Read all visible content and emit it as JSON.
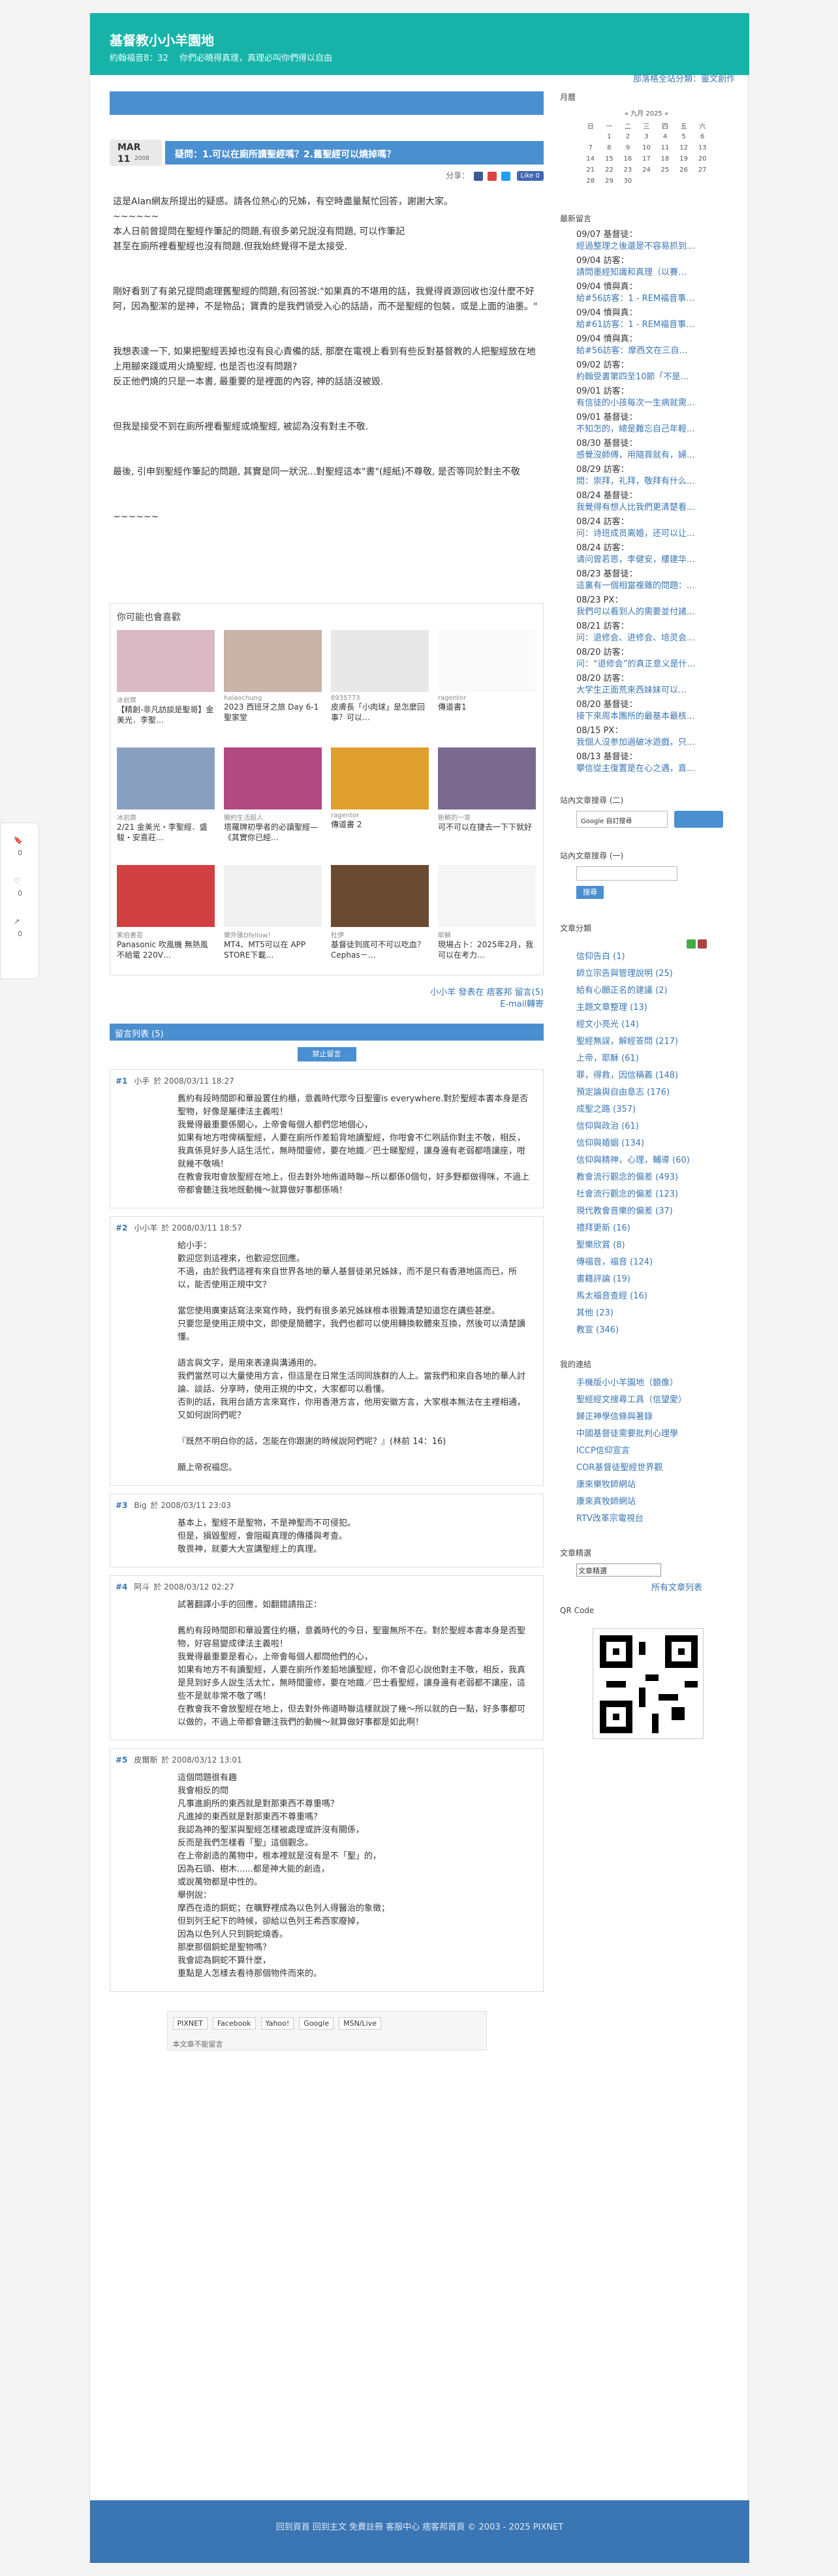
{
  "blog": {
    "title": "基督教小小羊園地",
    "desc": "約翰福音8：32 　你們必曉得真理，真理必叫你們得以自由",
    "toplink": "部落格全站分類：靈文創作"
  },
  "post": {
    "month": "MAR",
    "day": "11",
    "year": "2008",
    "title": "疑問：1.可以在廁所讀聖經嗎？2.舊聖經可以燒掉嗎？",
    "share_label": "分享：",
    "fb_like": "Like 0",
    "paragraphs": [
      "這是Alan網友所提出的疑惑。請各位熱心的兄姊，有空時盡量幫忙回答，謝謝大家。\n~~~~~~\n本人日前曾提問在聖經作筆記的問題,有很多弟兄說沒有問題, 可以作筆記\n甚至在廁所裡看聖經也沒有問題.但我始終覺得不是太接受.",
      "剛好看到了有弟兄提問處理舊聖經的問題,有回答說:\"如果真的不堪用的話，我覺得資源回收也沒什麼不好阿，因為聖潔的是神，不是物品；寶貴的是我們領受入心的話語，而不是聖經的包裝，或是上面的油墨。\"",
      "我想表達一下, 如果把聖經丟掉也沒有良心責備的話, 那麼在電視上看到有些反對基督教的人把聖經放在地上用腳來踐或用火燒聖經, 也是否也沒有問題?\n反正他們燒的只是一本書, 最重要的是裡面的內容, 神的話語沒被毀.",
      "但我是接受不到在廁所裡看聖經或燒聖經, 被認為沒有對主不敬.",
      "最後, 引申到聖經作筆記的問題, 其實是同一狀況...對聖經這本\"書\"(經紙)不尊敬, 是否等同於對主不敬",
      "~~~~~~"
    ],
    "related_title": "你可能也會喜歡",
    "related": [
      {
        "author": "冰岩齊",
        "title": "【精創-非凡訪談是聖哥】金美光．李聖…"
      },
      {
        "author": "haiaochung",
        "title": "2023 西班牙之旅 Day 6-1 聖家堂"
      },
      {
        "author": "8935773",
        "title": "皮膚長「小肉球」是怎麼回事？可以…"
      },
      {
        "author": "ragentor",
        "title": "傳道書1"
      },
      {
        "author": "冰岩齊",
        "title": "2/21 金美光・李聖經．盛駿・安喜莊…"
      },
      {
        "author": "簡約生活超人",
        "title": "塔羅牌初學者的必讀聖經—《其實你已經…"
      },
      {
        "author": "ragentor",
        "title": "傳道書 2"
      },
      {
        "author": "新鮮的一哥",
        "title": "可不可以在捷去一下下就好"
      },
      {
        "author": "紫伯書芸",
        "title": "Panasonic 吹風機 無熱風 不給電 220V…"
      },
      {
        "author": "樂外匯Dfellow！",
        "title": "MT4、MT5可以在 APP STORE下載…"
      },
      {
        "author": "杜伊",
        "title": "基督徒到底可不可以吃血？ Cephas－…"
      },
      {
        "author": "耶穌",
        "title": "現場占卜：2025年2月，我可以在考力…"
      }
    ],
    "footer_line1": "小小羊 發表在 痞客邦 留言(5)",
    "footer_line2": "E-mail轉寄"
  },
  "comments": {
    "header": "留言列表 (5)",
    "button": "禁止留言",
    "items": [
      {
        "num": "#1",
        "author": "小手",
        "date": "於 2008/03/11 18:27",
        "body": "舊約有段時間即和華設置住約櫃，意義時代眾今日聖靈is everywhere.對於聖經本書本身是否聖物，好像是屬律法主義啦！\n我覺得最重要係關心，上帝會每個人都們您地個心，\n如果有地方咁俾稱聖經，人要在廁所作差鉛背地讀聖經，你咁會不仁咧話你對主不敬，相反，我真係見好多人話生活忙，無時間靈修，要在地鐵／巴士睇聖經，讓身邊有老弱都唔讓座，咁就幾不敬喎！\n在教會我咁會放聖經在地上，但去對外地佈道時聯~所以都係0個句，好多野都做得咪，不過上帝都會聽注我地既動機～就算做好事都係喎！"
      },
      {
        "num": "#2",
        "author": "小小羊",
        "date": "於 2008/03/11 18:57",
        "body": "給小手：\n歡迎您到這裡來，也歡迎您回應。\n不過，由於我們這裡有來自世界各地的華人基督徒弟兄姊妹，而不是只有香港地區而已，所以，能否使用正規中文？\n\n當您使用廣東話寫法來寫作時，我們有很多弟兄姊妹根本很難清楚知道您在講些甚麼。\n只要您是使用正規中文，即使是簡體字，我們也都可以使用轉換軟體來互換，然後可以清楚讀懂。\n\n語言與文字，是用來表達與溝通用的。\n我們當然可以大量使用方言，但這是在日常生活同同族群的人上。當我們和來自各地的華人討論、談話、分享時，使用正規的中文，大家都可以看懂。\n否則的話，我用台語方言來寫作，你用香港方言，他用安徽方言，大家根本無法在主裡相通，又如何說同們呢？\n\n『既然不明白你的話，怎能在你跟謝的時候說阿們呢？』(林前 14：16)\n\n願上帝祝福您。"
      },
      {
        "num": "#3",
        "author": "Big",
        "date": "於 2008/03/11 23:03",
        "body": "基本上，聖經不是聖物，不是神聖而不可侵犯。\n但是，損毀聖經，會阻礙真理的傳播與考查。\n敬畏神，就要大大宣講聖經上的真理。"
      },
      {
        "num": "#4",
        "author": "阿斗",
        "date": "於 2008/03/12 02:27",
        "body": "試著翻譯小手的回應，如翻錯請指正：\n\n舊約有段時間即和華設置住約櫃，意義時代的今日，聖靈無所不在。對於聖經本書本身是否聖物，好容易變成律法主義啦！\n我覺得最重要是看心，上帝會每個人都問他們的心，\n如果有地方不有讀聖經，人要在廁所作差鉛地讀聖經，你不會忍心說他對主不敬，相反，我真是見到好多人說生活太忙，無時間靈修，要在地鐵／巴士看聖經，讓身邊有老弱都不讓座，這些不是就非常不敬了嗎！\n在教會我不會放聖經在地上，但去對外佈道時聯這樣就說了幾～所以就的白一點，好多事都可以做的，不過上帝都會聽注我們的動機～就算做好事都是如此啊！"
      },
      {
        "num": "#5",
        "author": "皮爾斯",
        "date": "於 2008/03/12 13:01",
        "body": "這個問題很有趣\n我會相反的問\n凡事進廁所的東西就是對那東西不尊重嗎？\n凡進掉的東西就是對那東西不尊重嗎？\n我認為神的聖潔與聖經怎樣被處理或許沒有關係，\n反而是我們怎樣看「聖」這個觀念。\n在上帝創造的萬物中，根本裡就是沒有是不「聖」的，\n因為石頭、樹木......都是神大能的創造，\n或說萬物都是中性的。\n舉例說：\n摩西在造的銅蛇；在曠野裡成為以色列人得醫治的象徵；\n但到列王紀下的時候，卻給以色列王希西家廢掉，\n因為以色列人只到銅蛇燒香。\n那麼那個銅蛇是聖物嗎？\n我會認為銅蛇不算什麼，\n重點是人怎樣去看待那個物件而來的。"
      }
    ]
  },
  "share_bar": {
    "items": [
      "PIXNET",
      "Facebook",
      "Yahoo!",
      "Google",
      "MSN/Live"
    ],
    "note": "本文章不能留言"
  },
  "footer": "回到頁首 回到主文 免費註冊 客服中心 痞客邦首頁 © 2003 - 2025 PIXNET",
  "side": {
    "cal_title": "月曆",
    "cal_month": "九月 2025",
    "weekdays": [
      "日",
      "一",
      "二",
      "三",
      "四",
      "五",
      "六"
    ],
    "weeks": [
      [
        "",
        "1",
        "2",
        "3",
        "4",
        "5",
        "6"
      ],
      [
        "7",
        "8",
        "9",
        "10",
        "11",
        "12",
        "13"
      ],
      [
        "14",
        "15",
        "16",
        "17",
        "18",
        "19",
        "20"
      ],
      [
        "21",
        "22",
        "23",
        "24",
        "25",
        "26",
        "27"
      ],
      [
        "28",
        "29",
        "30",
        "",
        "",
        "",
        ""
      ]
    ],
    "recent_title": "最新留言",
    "recent": [
      {
        "d": "09/07 基督徒：",
        "t": "經過整理之後還是不容易抓到…"
      },
      {
        "d": "09/04 訪客：",
        "t": "請問墨經知識和真理（以賽…"
      },
      {
        "d": "09/04 憤與真：",
        "t": "給#56訪客：1 - REM福音事…"
      },
      {
        "d": "09/04 憤與真：",
        "t": "給#61訪客：1 - REM福音事…"
      },
      {
        "d": "09/04 憤與真：",
        "t": "給#56訪客：摩西文在三自…"
      },
      {
        "d": "09/02 訪客：",
        "t": "約翰受書第四至10節「不是…"
      },
      {
        "d": "09/01 訪客：",
        "t": "有信徒的小孩每次一生病就需…"
      },
      {
        "d": "09/01 基督徒：",
        "t": "不知怎的，總是難忘自己年輕…"
      },
      {
        "d": "08/30 基督徒：",
        "t": "感覺沒師傅，用隨買就有，婦…"
      },
      {
        "d": "08/29 訪客：",
        "t": "問：崇拜，礼拜，敬拜有什么…"
      },
      {
        "d": "08/24 基督徒：",
        "t": "我覺得有想人比我們更清楚看…"
      },
      {
        "d": "08/24 訪客：",
        "t": "问：诗班成员离婚，还可以让…"
      },
      {
        "d": "08/24 訪客：",
        "t": "请问曾若恩，李健安，樓建华…"
      },
      {
        "d": "08/23 基督徒：",
        "t": "這裏有一個相當複雜的問題：…"
      },
      {
        "d": "08/23 PX：",
        "t": "我們可以看到人的需要並付諸…"
      },
      {
        "d": "08/21 訪客：",
        "t": "问：退修会、进修会、培灵会…"
      },
      {
        "d": "08/20 訪客：",
        "t": "问：“退修会”的真正意义是什…"
      },
      {
        "d": "08/20 訪客：",
        "t": "大学生正面荒來西妹妹可以…"
      },
      {
        "d": "08/20 基督徒：",
        "t": "接下來周本團所的最基本最核…"
      },
      {
        "d": "08/15 PX：",
        "t": "我個人沒参加過破冰遊戲，只…"
      },
      {
        "d": "08/13 基督徒：",
        "t": "攀信從主復置是在心之遇，直…"
      }
    ],
    "search1_title": "站內文章搜尋 (二)",
    "g_label": "Google 自訂搜尋",
    "search2_title": "站內文章搜尋 (一)",
    "search_btn": "搜尋",
    "cat_title": "文章分類",
    "cats": [
      "信仰告白 (1)",
      "師立宗告與管理說明 (25)",
      "給有心願正名的建議 (2)",
      "主題文章整理 (13)",
      "經文小亮光 (14)",
      "聖經無誤，解經答問 (217)",
      "上帝，耶穌 (61)",
      "罪，得救，因信稱義 (148)",
      "預定論與自由意志 (176)",
      "成聖之路 (357)",
      "信仰與政治 (61)",
      "信仰與婚姻 (134)",
      "信仰與精神，心理，輔導 (60)",
      "教會流行觀念的偏差 (493)",
      "社會流行觀念的偏差 (123)",
      "現代教會音樂的偏差 (37)",
      "禮拜更新 (16)",
      "聖樂欣賞 (8)",
      "傳福音，福音 (124)",
      "書籍評論 (19)",
      "馬太福音查經 (16)",
      "其他 (23)",
      "教宣 (346)"
    ],
    "links_title": "我的連結",
    "links": [
      "手機版小小羊園地（鏡像）",
      "聖經經文搜尋工具（信望愛）",
      "歸正神學信條與著錄",
      "中國基督徒需要批判心理學",
      "ICCP信仰宣言",
      "COR基督徒聖經世界觀",
      "康來樂牧師網站",
      "康來真牧師網站",
      "RTV改革宗電視台"
    ],
    "archive_title": "文章精選",
    "archive_select": "文章精選",
    "archive_link": "所有文章列表",
    "qr_title": "QR Code"
  },
  "leftfloat": {
    "c1": "0",
    "c2": "0",
    "c3": "0"
  }
}
